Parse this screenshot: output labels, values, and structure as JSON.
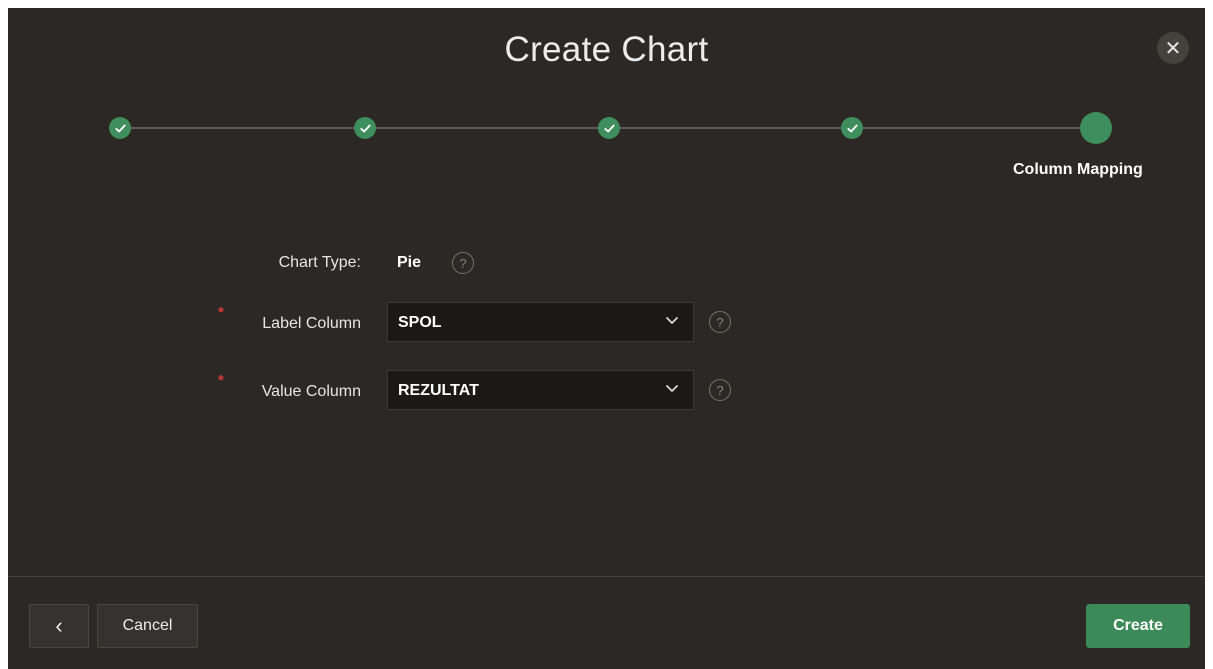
{
  "dialog": {
    "title": "Create Chart",
    "close_icon": "close-icon"
  },
  "wizard": {
    "steps": [
      {
        "status": "complete",
        "label": ""
      },
      {
        "status": "complete",
        "label": ""
      },
      {
        "status": "complete",
        "label": ""
      },
      {
        "status": "complete",
        "label": ""
      },
      {
        "status": "current",
        "label": "Column Mapping"
      }
    ],
    "active_color": "#3f8e5d"
  },
  "form": {
    "chart_type": {
      "label": "Chart Type:",
      "value": "Pie"
    },
    "label_column": {
      "label": "Label Column",
      "value": "SPOL",
      "required": true
    },
    "value_column": {
      "label": "Value Column",
      "value": "REZULTAT",
      "required": true
    },
    "help_glyph": "?",
    "required_glyph": "*"
  },
  "footer": {
    "back_glyph": "‹",
    "cancel_label": "Cancel",
    "create_label": "Create"
  },
  "colors": {
    "background": "#2c2825",
    "primary_button": "#3d8a59",
    "required": "#d83b3b"
  }
}
